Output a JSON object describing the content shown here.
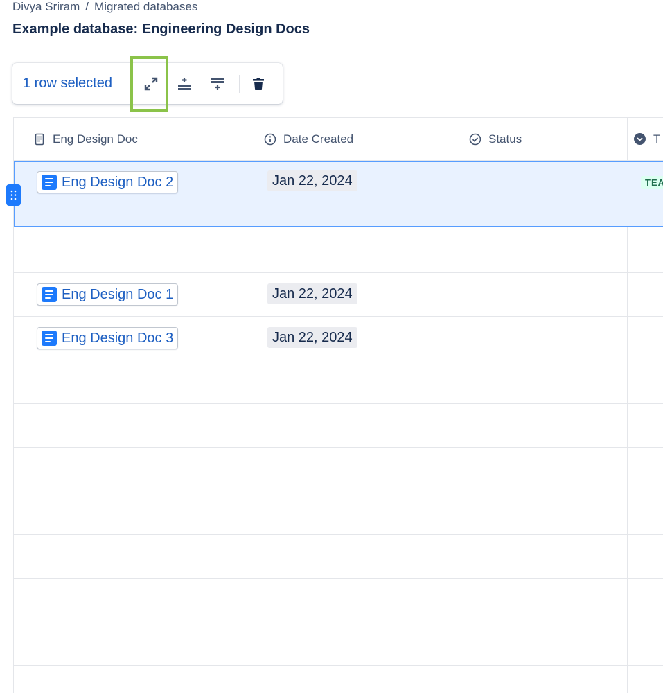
{
  "breadcrumb": {
    "owner": "Divya Sriram",
    "separator": "/",
    "parent": "Migrated databases"
  },
  "page": {
    "title": "Example database: Engineering Design Docs"
  },
  "toolbar": {
    "selection_text": "1 row selected",
    "icons": [
      "expand-icon",
      "insert-row-icon",
      "insert-row-below-icon",
      "delete-icon"
    ]
  },
  "table": {
    "columns": [
      {
        "label": "Eng Design Doc",
        "icon": "page-icon"
      },
      {
        "label": "Date Created",
        "icon": "info-icon"
      },
      {
        "label": "Status",
        "icon": "check-circle-icon"
      },
      {
        "label": "T",
        "icon": "dropdown-circle-icon"
      }
    ],
    "rows": [
      {
        "doc": "Eng Design Doc 2",
        "date": "Jan 22, 2024",
        "status": "",
        "tag": "TEA",
        "selected": true
      },
      {
        "doc": "",
        "date": "",
        "status": "",
        "tag": ""
      },
      {
        "doc": "Eng Design Doc 1",
        "date": "Jan 22, 2024",
        "status": "",
        "tag": ""
      },
      {
        "doc": "Eng Design Doc 3",
        "date": "Jan 22, 2024",
        "status": "",
        "tag": ""
      }
    ]
  },
  "colors": {
    "accent": "#1d7afc",
    "selected_row_bg": "#e9f2ff",
    "selected_row_border": "#579dff",
    "highlight": "#8bc34a",
    "tag_bg": "#dcfff1",
    "tag_text": "#216e4e"
  }
}
